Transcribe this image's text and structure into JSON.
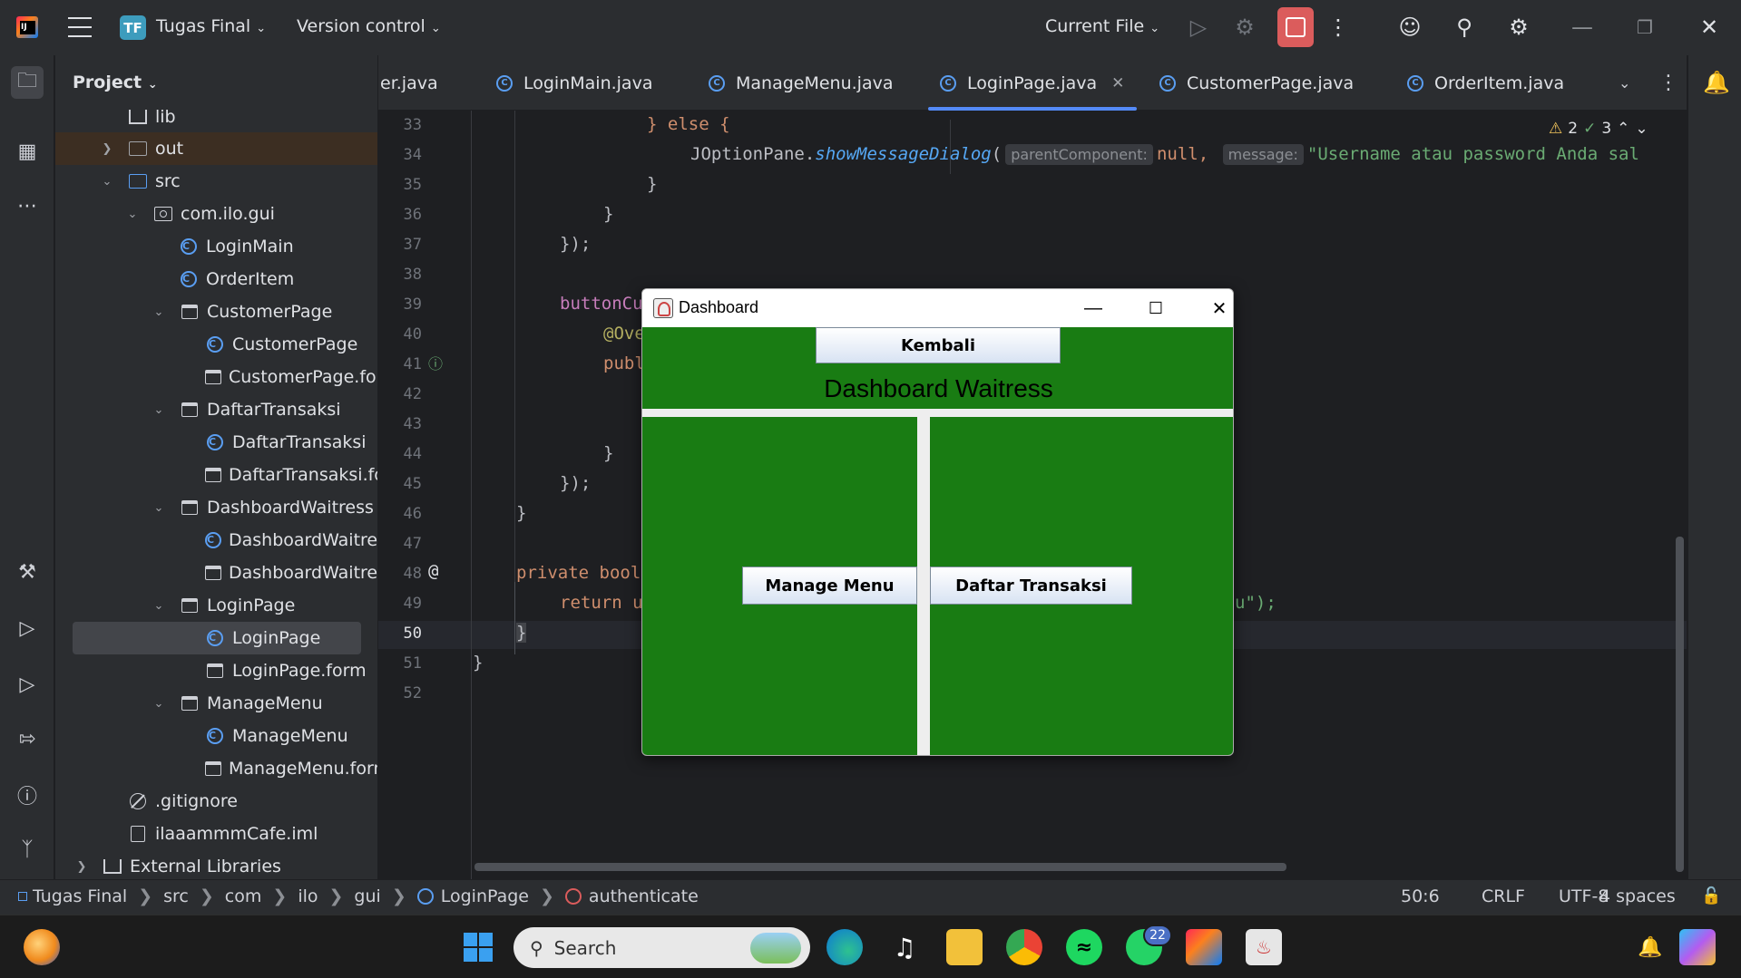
{
  "titlebar": {
    "project_badge": "TF",
    "project_name": "Tugas Final",
    "version_control": "Version control",
    "run_config": "Current File",
    "icons": [
      "hamburger-menu-icon",
      "run-icon",
      "debug-icon",
      "stop-icon",
      "more-icon",
      "add-user-icon",
      "search-icon",
      "settings-icon",
      "minimize-icon",
      "restore-icon",
      "close-icon"
    ]
  },
  "project_panel": {
    "title": "Project",
    "tree": [
      {
        "label": "lib",
        "icon": "library-icon"
      },
      {
        "label": "out",
        "icon": "folder-icon"
      },
      {
        "label": "src",
        "icon": "folder-icon"
      },
      {
        "label": "com.ilo.gui",
        "icon": "package-icon"
      },
      {
        "label": "LoginMain",
        "icon": "class-icon"
      },
      {
        "label": "OrderItem",
        "icon": "class-icon"
      },
      {
        "label": "CustomerPage",
        "icon": "form-icon"
      },
      {
        "label": "CustomerPage",
        "icon": "class-icon"
      },
      {
        "label": "CustomerPage.form",
        "icon": "form-icon"
      },
      {
        "label": "DaftarTransaksi",
        "icon": "form-icon"
      },
      {
        "label": "DaftarTransaksi",
        "icon": "class-icon"
      },
      {
        "label": "DaftarTransaksi.form",
        "icon": "form-icon"
      },
      {
        "label": "DashboardWaitress",
        "icon": "form-icon"
      },
      {
        "label": "DashboardWaitress",
        "icon": "class-icon"
      },
      {
        "label": "DashboardWaitress.form",
        "icon": "form-icon"
      },
      {
        "label": "LoginPage",
        "icon": "form-icon"
      },
      {
        "label": "LoginPage",
        "icon": "class-icon"
      },
      {
        "label": "LoginPage.form",
        "icon": "form-icon"
      },
      {
        "label": "ManageMenu",
        "icon": "form-icon"
      },
      {
        "label": "ManageMenu",
        "icon": "class-icon"
      },
      {
        "label": "ManageMenu.form",
        "icon": "form-icon"
      },
      {
        "label": ".gitignore",
        "icon": "gitignore-icon"
      },
      {
        "label": "ilaaammmCafe.iml",
        "icon": "iml-icon"
      },
      {
        "label": "External Libraries",
        "icon": "library-icon"
      }
    ]
  },
  "tabs": [
    {
      "label": "er.java"
    },
    {
      "label": "LoginMain.java"
    },
    {
      "label": "ManageMenu.java"
    },
    {
      "label": "LoginPage.java",
      "active": true
    },
    {
      "label": "CustomerPage.java"
    },
    {
      "label": "OrderItem.java"
    }
  ],
  "editor": {
    "line_numbers": [
      "33",
      "34",
      "35",
      "36",
      "37",
      "38",
      "39",
      "40",
      "41",
      "42",
      "43",
      "44",
      "45",
      "46",
      "47",
      "48",
      "49",
      "50",
      "51",
      "52"
    ],
    "warnings": "2",
    "ok_count": "3",
    "lines": {
      "l33": "} else {",
      "l34_pre": "JOptionPane.",
      "l34_fn": "showMessageDialog",
      "l34_open": "(",
      "l34_hint1": "parentComponent:",
      "l34_null": "null,",
      "l34_hint2": "message:",
      "l34_str": "\"Username atau password Anda sal",
      "l35": "}",
      "l36": "}",
      "l37": "});",
      "l39": "buttonCu",
      "l40": "@Ove",
      "l41": "publ",
      "l44": "}",
      "l45": "});",
      "l46": "}",
      "l48_kw": "private bool",
      "l49_kw": "return u",
      "l49_tail": "u\");",
      "l50": "}",
      "l51": "}"
    }
  },
  "dashboard": {
    "window_title": "Dashboard",
    "back_button": "Kembali",
    "heading": "Dashboard Waitress",
    "manage_menu_button": "Manage Menu",
    "transactions_button": "Daftar Transaksi",
    "body_color": "#197c13"
  },
  "statusbar": {
    "crumbs": [
      "Tugas Final",
      "src",
      "com",
      "ilo",
      "gui",
      "LoginPage",
      "authenticate"
    ],
    "position": "50:6",
    "line_sep": "CRLF",
    "encoding": "UTF-8",
    "indent": "4 spaces"
  },
  "taskbar": {
    "search_placeholder": "Search",
    "whatsapp_badge": "22"
  }
}
